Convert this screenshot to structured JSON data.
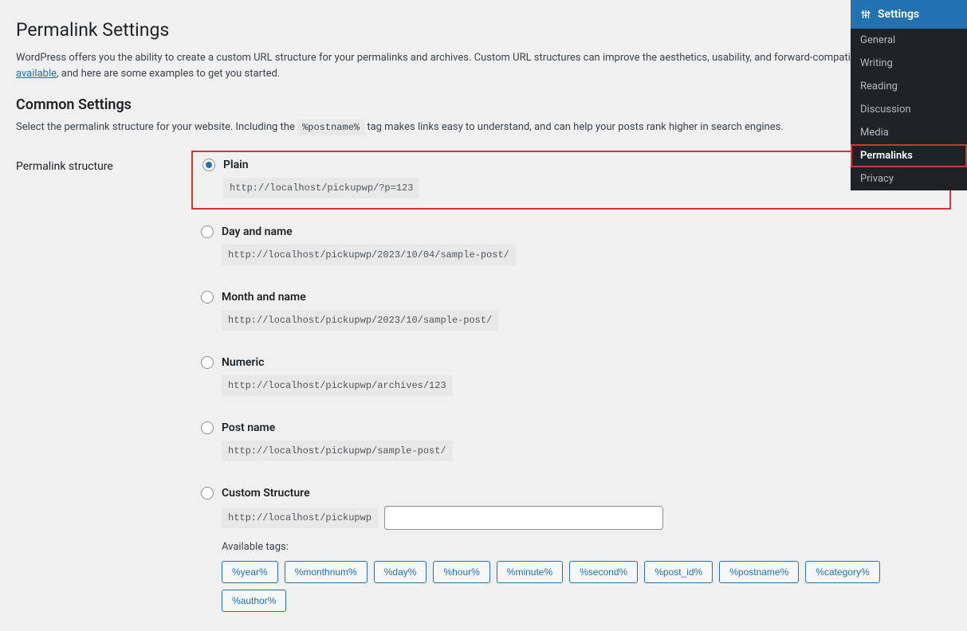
{
  "page": {
    "title": "Permalink Settings",
    "intro_pre": "WordPress offers you the ability to create a custom URL structure for your permalinks and archives. Custom URL structures can improve the aesthetics, usability, and forward-compatib",
    "intro_link": "number of tags are available",
    "intro_post": ", and here are some examples to get you started.",
    "section_heading": "Common Settings",
    "section_sub_pre": "Select the permalink structure for your website. Including the ",
    "section_sub_tag": "%postname%",
    "section_sub_post": " tag makes links easy to understand, and can help your posts rank higher in search engines.",
    "field_label": "Permalink structure"
  },
  "options": [
    {
      "label": "Plain",
      "url": "http://localhost/pickupwp/?p=123",
      "checked": true,
      "highlighted": true
    },
    {
      "label": "Day and name",
      "url": "http://localhost/pickupwp/2023/10/04/sample-post/",
      "checked": false,
      "highlighted": false
    },
    {
      "label": "Month and name",
      "url": "http://localhost/pickupwp/2023/10/sample-post/",
      "checked": false,
      "highlighted": false
    },
    {
      "label": "Numeric",
      "url": "http://localhost/pickupwp/archives/123",
      "checked": false,
      "highlighted": false
    },
    {
      "label": "Post name",
      "url": "http://localhost/pickupwp/sample-post/",
      "checked": false,
      "highlighted": false
    }
  ],
  "custom": {
    "label": "Custom Structure",
    "prefix": "http://localhost/pickupwp",
    "value": "",
    "available_label": "Available tags:"
  },
  "tags": [
    "%year%",
    "%monthnum%",
    "%day%",
    "%hour%",
    "%minute%",
    "%second%",
    "%post_id%",
    "%postname%",
    "%category%",
    "%author%"
  ],
  "sidebar": {
    "title": "Settings",
    "items": [
      {
        "label": "General",
        "active": false
      },
      {
        "label": "Writing",
        "active": false
      },
      {
        "label": "Reading",
        "active": false
      },
      {
        "label": "Discussion",
        "active": false
      },
      {
        "label": "Media",
        "active": false
      },
      {
        "label": "Permalinks",
        "active": true
      },
      {
        "label": "Privacy",
        "active": false
      }
    ]
  }
}
